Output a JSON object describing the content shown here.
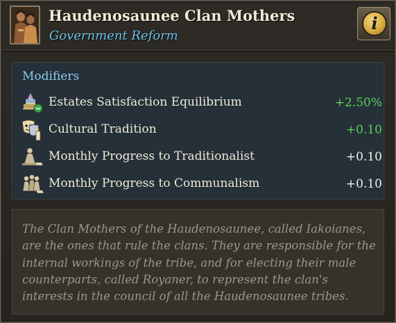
{
  "header": {
    "title": "Haudenosaunee Clan Mothers",
    "subtitle": "Government Reform",
    "info_icon": "info-icon",
    "info_glyph": "i"
  },
  "modifiers": {
    "heading": "Modifiers",
    "rows": [
      {
        "icon": "estates-pyramid-icon",
        "label": "Estates Satisfaction Equilibrium",
        "value": "+2.50%",
        "color": "#5fd05a"
      },
      {
        "icon": "culture-masks-icon",
        "label": "Cultural Tradition",
        "value": "+0.10",
        "color": "#5fd05a"
      },
      {
        "icon": "traditionalist-figure-icon",
        "label": "Monthly Progress to Traditionalist",
        "value": "+0.10",
        "color": "#f4f0e6"
      },
      {
        "icon": "communalism-figures-icon",
        "label": "Monthly Progress to Communalism",
        "value": "+0.10",
        "color": "#f4f0e6"
      }
    ]
  },
  "description": "The Clan Mothers of the Haudenosaunee, called Iakoianes, are the ones that rule the clans. They are responsible for the internal workings of the tribe, and for electing their male counterparts, called Royaner, to represent the clan's interests in the council of all the Haudenosaunee tribes.",
  "colors": {
    "subtitle": "#6ec2e8",
    "positive": "#5fd05a",
    "neutral": "#f4f0e6",
    "modifier_bg": "#253038",
    "description_bg": "#35322c"
  }
}
